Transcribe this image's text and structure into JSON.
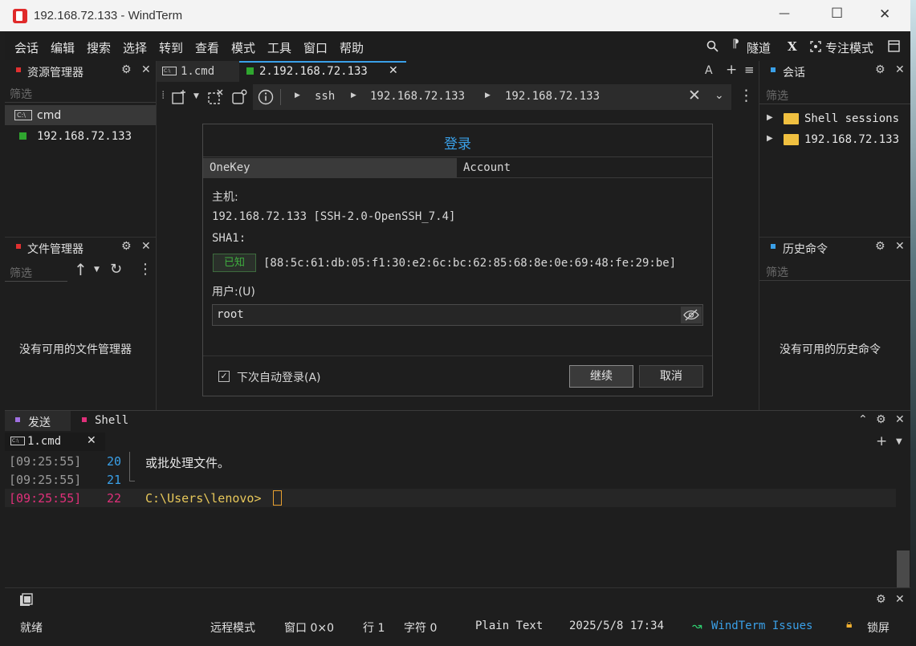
{
  "window": {
    "title": "192.168.72.133 - WindTerm",
    "minimize": "—",
    "maximize": "☐",
    "close": "✕"
  },
  "menu": {
    "items": [
      "会话",
      "编辑",
      "搜索",
      "选择",
      "转到",
      "查看",
      "模式",
      "工具",
      "窗口",
      "帮助"
    ],
    "tunnel_label": "隧道",
    "x_label": "X",
    "focus_mode_label": "专注模式"
  },
  "resource_panel": {
    "title": "资源管理器",
    "filter_placeholder": "筛选",
    "items": [
      {
        "label": "cmd",
        "icon": "cmd-icon"
      },
      {
        "label": "192.168.72.133",
        "icon": "session-square-icon",
        "color": "#2fa62f"
      }
    ]
  },
  "file_panel": {
    "title": "文件管理器",
    "filter_placeholder": "筛选",
    "empty_text": "没有可用的文件管理器"
  },
  "tabs": [
    {
      "label": "1.cmd",
      "active": false
    },
    {
      "label": "2.192.168.72.133",
      "active": true
    }
  ],
  "tab_controls": {
    "font": "A",
    "add": "+",
    "menu": "≡"
  },
  "address_bar": {
    "segments": [
      "ssh",
      "192.168.72.133",
      "192.168.72.133"
    ]
  },
  "login_dialog": {
    "title": "登录",
    "tabs": [
      "OneKey",
      "Account"
    ],
    "host_label": "主机:",
    "host_value": "192.168.72.133 [SSH-2.0-OpenSSH_7.4]",
    "sha_label": "SHA1:",
    "known_badge": "已知",
    "fingerprint": "[88:5c:61:db:05:f1:30:e2:6c:bc:62:85:68:8e:0e:69:48:fe:29:be]",
    "user_label": "用户:(U)",
    "user_value": "root",
    "auto_login_label": "下次自动登录(A)",
    "auto_login_checked": true,
    "continue_button": "继续",
    "cancel_button": "取消"
  },
  "session_panel": {
    "title": "会话",
    "filter_placeholder": "筛选",
    "items": [
      "Shell sessions",
      "192.168.72.133"
    ]
  },
  "history_panel": {
    "title": "历史命令",
    "filter_placeholder": "筛选",
    "empty_text": "没有可用的历史命令"
  },
  "bottom_tabs": [
    {
      "label": "发送",
      "color": "#a070e0"
    },
    {
      "label": "Shell",
      "color": "#e0307a"
    }
  ],
  "terminal": {
    "tab_label": "1.cmd",
    "lines": [
      {
        "time": "[09:25:55]",
        "num": "20",
        "text": "或批处理文件。",
        "current": false
      },
      {
        "time": "[09:25:55]",
        "num": "21",
        "text": "",
        "current": false
      },
      {
        "time": "[09:25:55]",
        "num": "22",
        "text": "C:\\Users\\lenovo>",
        "current": true
      }
    ]
  },
  "status_bar": {
    "ready": "就绪",
    "remote_mode": "远程模式",
    "window": "窗口 0×0",
    "row": "行 1",
    "chars": "字符 0",
    "encoding": "Plain Text",
    "datetime": "2025/5/8 17:34",
    "issues": "WindTerm Issues",
    "lock": "锁屏"
  },
  "colors": {
    "accent_blue": "#3aa0e8",
    "terminal_pink": "#e0307a",
    "terminal_yellow": "#e8c85a",
    "timestamp_gray": "#9a9a9a"
  }
}
